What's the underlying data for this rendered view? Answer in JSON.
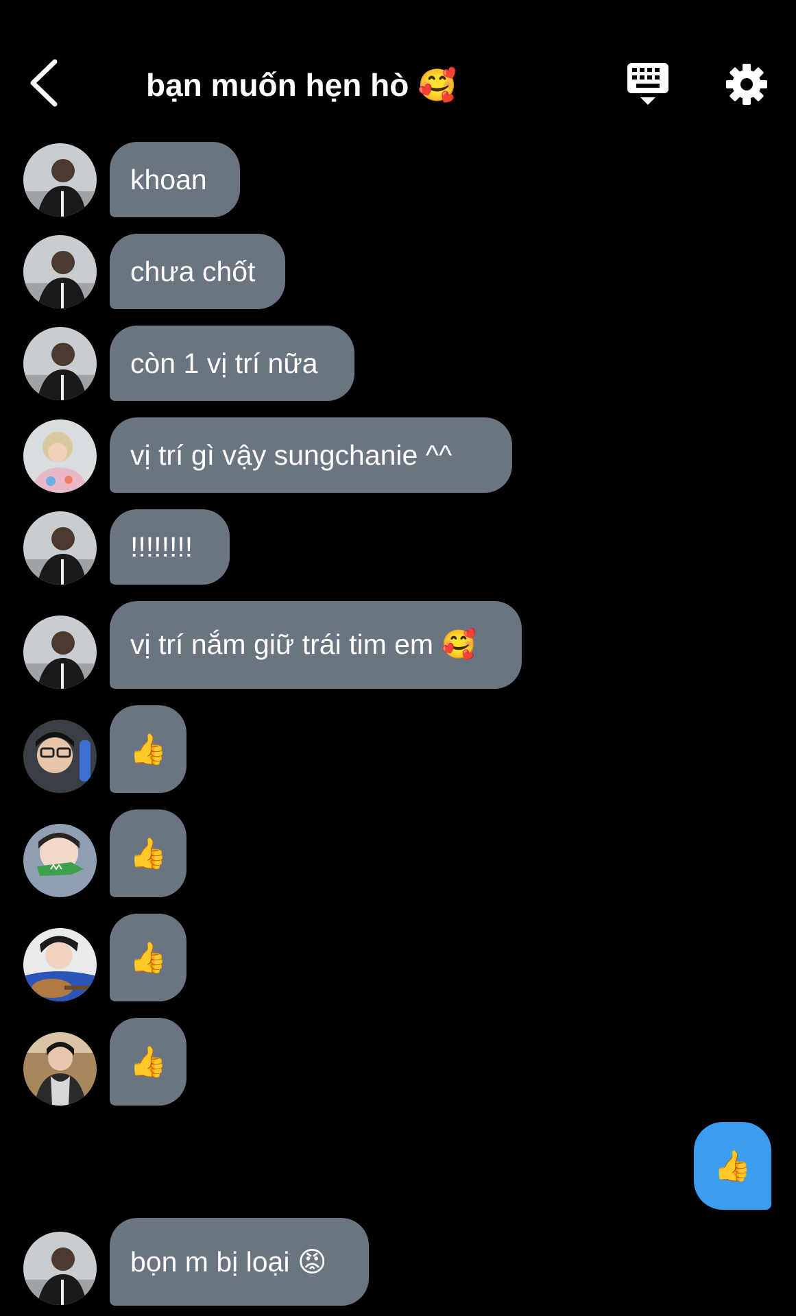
{
  "header": {
    "title": "bạn muốn hẹn hò 🥰",
    "back_icon": "chevron-left-icon",
    "keyboard_icon": "keyboard-icon",
    "settings_icon": "gear-icon"
  },
  "colors": {
    "background": "#000000",
    "incoming_bubble": "#6a7581",
    "outgoing_bubble": "#3c9cf0",
    "text": "#ffffff"
  },
  "messages": [
    {
      "sender": "sungchanie",
      "text": "khoan"
    },
    {
      "sender": "sungchanie",
      "text": "chưa chốt"
    },
    {
      "sender": "sungchanie",
      "text": "còn 1 vị trí nữa"
    },
    {
      "sender": "member-2",
      "text": "vị trí gì vậy sungchanie ^^"
    },
    {
      "sender": "sungchanie",
      "text": "!!!!!!!!"
    },
    {
      "sender": "sungchanie",
      "text": "vị trí nắm giữ trái tim em 🥰"
    },
    {
      "sender": "member-3",
      "text": "👍"
    },
    {
      "sender": "member-4",
      "text": "👍"
    },
    {
      "sender": "member-5",
      "text": "👍"
    },
    {
      "sender": "member-6",
      "text": "👍"
    },
    {
      "sender": "me",
      "text": "👍"
    },
    {
      "sender": "sungchanie",
      "text": "bọn m bị loại 😡"
    }
  ]
}
